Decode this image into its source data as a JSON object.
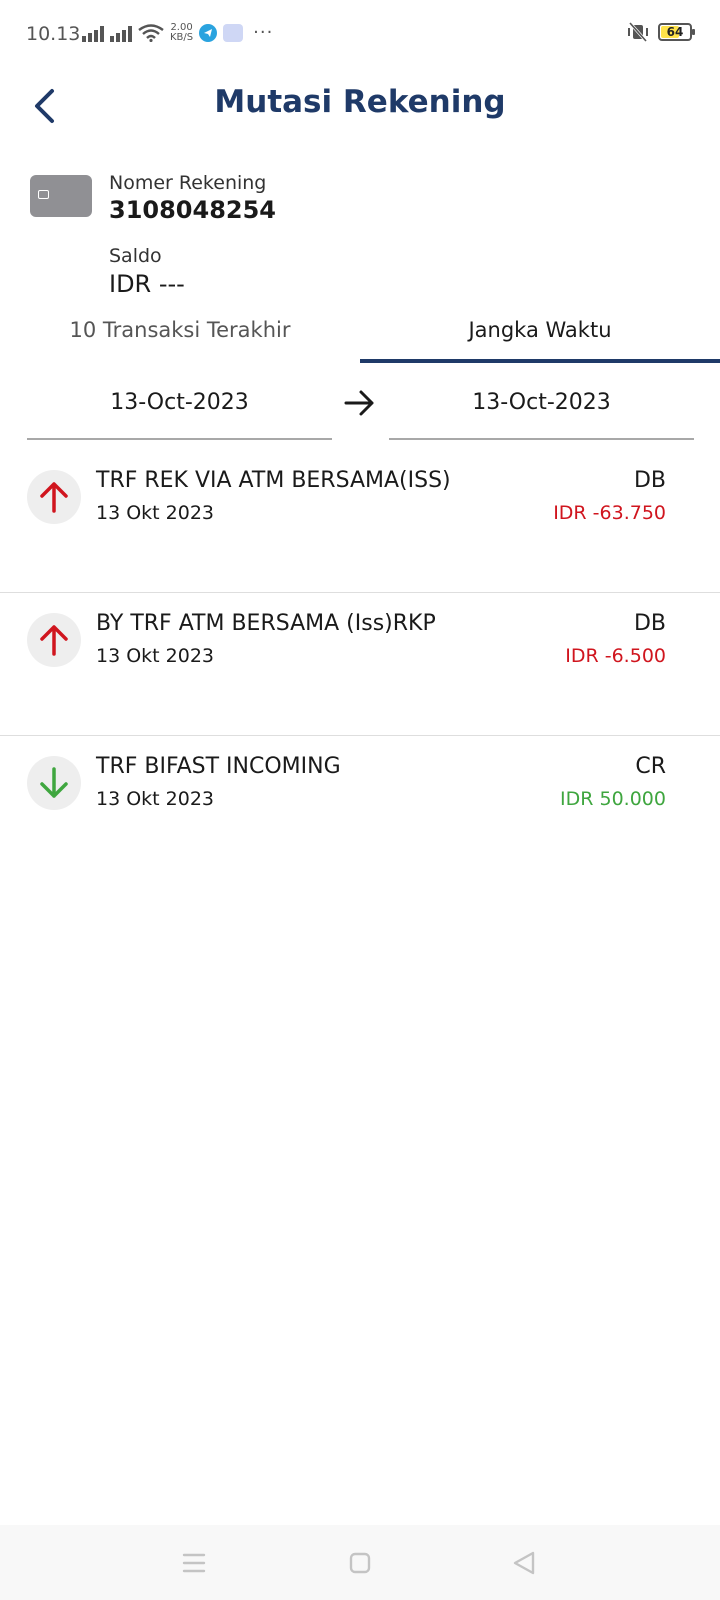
{
  "status_bar": {
    "time": "10.13",
    "net_speed_value": "2.00",
    "net_speed_unit": "KB/S",
    "battery_level": "64",
    "battery_percent": 64,
    "more": "···",
    "icons": [
      "signal-icon",
      "signal-icon",
      "wifi-icon",
      "telegram-icon",
      "app-icon",
      "vibrate-off-icon",
      "battery-icon"
    ]
  },
  "header": {
    "title": "Mutasi Rekening",
    "back_icon": "chevron-left-icon"
  },
  "account": {
    "number_label": "Nomer Rekening",
    "number": "3108048254",
    "balance_label": "Saldo",
    "balance": "IDR ---",
    "card_icon": "card-icon"
  },
  "tabs": [
    {
      "label": "10 Transaksi Terakhir",
      "active": false
    },
    {
      "label": "Jangka Waktu",
      "active": true
    }
  ],
  "date_range": {
    "from": "13-Oct-2023",
    "to": "13-Oct-2023",
    "arrow_icon": "arrow-right-icon"
  },
  "transactions": [
    {
      "description": "TRF REK VIA ATM BERSAMA(ISS)",
      "date": "13 Okt 2023",
      "type": "DB",
      "amount": "IDR -63.750",
      "direction": "out"
    },
    {
      "description": "BY TRF ATM BERSAMA (Iss)RKP",
      "date": "13 Okt 2023",
      "type": "DB",
      "amount": "IDR -6.500",
      "direction": "out"
    },
    {
      "description": "TRF BIFAST INCOMING",
      "date": "13 Okt 2023",
      "type": "CR",
      "amount": "IDR 50.000",
      "direction": "in"
    }
  ],
  "colors": {
    "primary": "#1f3a68",
    "debit": "#d0151e",
    "credit": "#3fa63f"
  },
  "nav_bar": {
    "icons": [
      "menu-icon",
      "home-icon",
      "back-triangle-icon"
    ]
  }
}
